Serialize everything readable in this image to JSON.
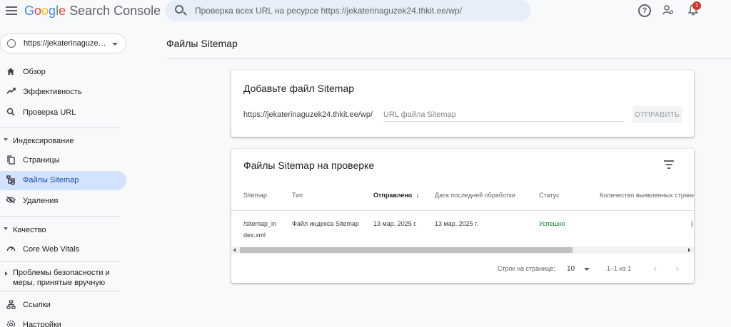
{
  "app": {
    "logo_parts": [
      "G",
      "o",
      "o",
      "g",
      "l",
      "e"
    ],
    "product": "Search Console",
    "search_placeholder": "Проверка всех URL на ресурсе https://jekaterinaguzek24.thkit.ee/wp/",
    "notification_count": "1"
  },
  "sidebar": {
    "property": "https://jekaterinaguzek24.thkit.ee/wp/",
    "items": [
      {
        "label": "Обзор",
        "icon": "home-icon"
      },
      {
        "label": "Эффективность",
        "icon": "trending-up-icon"
      },
      {
        "label": "Проверка URL",
        "icon": "search-icon"
      }
    ],
    "sections": [
      {
        "label": "Индексирование",
        "items": [
          {
            "label": "Страницы",
            "icon": "pages-icon"
          },
          {
            "label": "Файлы Sitemap",
            "icon": "sitemap-icon",
            "active": true
          },
          {
            "label": "Удаления",
            "icon": "visibility-off-icon"
          }
        ]
      },
      {
        "label": "Качество",
        "items": [
          {
            "label": "Core Web Vitals",
            "icon": "speed-gauge-icon"
          }
        ]
      },
      {
        "label": "Проблемы безопасности и меры, принятые вручную",
        "items": []
      }
    ],
    "bottom_items": [
      {
        "label": "Ссылки",
        "icon": "links-icon"
      },
      {
        "label": "Настройки",
        "icon": "settings-icon"
      }
    ]
  },
  "main": {
    "title": "Файлы Sitemap",
    "add_card": {
      "title": "Добавьте файл Sitemap",
      "prefix": "https://jekaterinaguzek24.thkit.ee/wp/",
      "placeholder": "URL файла Sitemap",
      "submit": "ОТПРАВИТЬ"
    },
    "list_card": {
      "title": "Файлы Sitemap на проверке",
      "columns": [
        "Sitemap",
        "Тип",
        "Отправлено",
        "Дата последней обработки",
        "Статус",
        "Количество выявленных страни"
      ],
      "rows": [
        {
          "sitemap_line1": "/sitemap_in",
          "sitemap_line2": "dex.xml",
          "type": "Файл индекса Sitemap",
          "submitted": "13 мар. 2025 г.",
          "processed": "13 мар. 2025 г.",
          "status": "Успешно",
          "count_fragment": "("
        }
      ],
      "pager": {
        "rows_label": "Строк на странице:",
        "rows_value": "10",
        "range": "1–1 из 1",
        "prev": "‹",
        "next": "›"
      }
    }
  }
}
